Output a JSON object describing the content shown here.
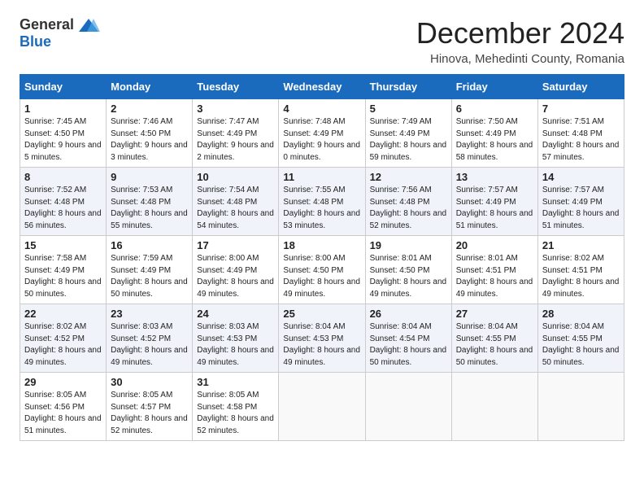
{
  "header": {
    "logo_general": "General",
    "logo_blue": "Blue",
    "title": "December 2024",
    "subtitle": "Hinova, Mehedinti County, Romania"
  },
  "weekdays": [
    "Sunday",
    "Monday",
    "Tuesday",
    "Wednesday",
    "Thursday",
    "Friday",
    "Saturday"
  ],
  "weeks": [
    [
      {
        "day": "1",
        "sunrise": "Sunrise: 7:45 AM",
        "sunset": "Sunset: 4:50 PM",
        "daylight": "Daylight: 9 hours and 5 minutes."
      },
      {
        "day": "2",
        "sunrise": "Sunrise: 7:46 AM",
        "sunset": "Sunset: 4:50 PM",
        "daylight": "Daylight: 9 hours and 3 minutes."
      },
      {
        "day": "3",
        "sunrise": "Sunrise: 7:47 AM",
        "sunset": "Sunset: 4:49 PM",
        "daylight": "Daylight: 9 hours and 2 minutes."
      },
      {
        "day": "4",
        "sunrise": "Sunrise: 7:48 AM",
        "sunset": "Sunset: 4:49 PM",
        "daylight": "Daylight: 9 hours and 0 minutes."
      },
      {
        "day": "5",
        "sunrise": "Sunrise: 7:49 AM",
        "sunset": "Sunset: 4:49 PM",
        "daylight": "Daylight: 8 hours and 59 minutes."
      },
      {
        "day": "6",
        "sunrise": "Sunrise: 7:50 AM",
        "sunset": "Sunset: 4:49 PM",
        "daylight": "Daylight: 8 hours and 58 minutes."
      },
      {
        "day": "7",
        "sunrise": "Sunrise: 7:51 AM",
        "sunset": "Sunset: 4:48 PM",
        "daylight": "Daylight: 8 hours and 57 minutes."
      }
    ],
    [
      {
        "day": "8",
        "sunrise": "Sunrise: 7:52 AM",
        "sunset": "Sunset: 4:48 PM",
        "daylight": "Daylight: 8 hours and 56 minutes."
      },
      {
        "day": "9",
        "sunrise": "Sunrise: 7:53 AM",
        "sunset": "Sunset: 4:48 PM",
        "daylight": "Daylight: 8 hours and 55 minutes."
      },
      {
        "day": "10",
        "sunrise": "Sunrise: 7:54 AM",
        "sunset": "Sunset: 4:48 PM",
        "daylight": "Daylight: 8 hours and 54 minutes."
      },
      {
        "day": "11",
        "sunrise": "Sunrise: 7:55 AM",
        "sunset": "Sunset: 4:48 PM",
        "daylight": "Daylight: 8 hours and 53 minutes."
      },
      {
        "day": "12",
        "sunrise": "Sunrise: 7:56 AM",
        "sunset": "Sunset: 4:48 PM",
        "daylight": "Daylight: 8 hours and 52 minutes."
      },
      {
        "day": "13",
        "sunrise": "Sunrise: 7:57 AM",
        "sunset": "Sunset: 4:49 PM",
        "daylight": "Daylight: 8 hours and 51 minutes."
      },
      {
        "day": "14",
        "sunrise": "Sunrise: 7:57 AM",
        "sunset": "Sunset: 4:49 PM",
        "daylight": "Daylight: 8 hours and 51 minutes."
      }
    ],
    [
      {
        "day": "15",
        "sunrise": "Sunrise: 7:58 AM",
        "sunset": "Sunset: 4:49 PM",
        "daylight": "Daylight: 8 hours and 50 minutes."
      },
      {
        "day": "16",
        "sunrise": "Sunrise: 7:59 AM",
        "sunset": "Sunset: 4:49 PM",
        "daylight": "Daylight: 8 hours and 50 minutes."
      },
      {
        "day": "17",
        "sunrise": "Sunrise: 8:00 AM",
        "sunset": "Sunset: 4:49 PM",
        "daylight": "Daylight: 8 hours and 49 minutes."
      },
      {
        "day": "18",
        "sunrise": "Sunrise: 8:00 AM",
        "sunset": "Sunset: 4:50 PM",
        "daylight": "Daylight: 8 hours and 49 minutes."
      },
      {
        "day": "19",
        "sunrise": "Sunrise: 8:01 AM",
        "sunset": "Sunset: 4:50 PM",
        "daylight": "Daylight: 8 hours and 49 minutes."
      },
      {
        "day": "20",
        "sunrise": "Sunrise: 8:01 AM",
        "sunset": "Sunset: 4:51 PM",
        "daylight": "Daylight: 8 hours and 49 minutes."
      },
      {
        "day": "21",
        "sunrise": "Sunrise: 8:02 AM",
        "sunset": "Sunset: 4:51 PM",
        "daylight": "Daylight: 8 hours and 49 minutes."
      }
    ],
    [
      {
        "day": "22",
        "sunrise": "Sunrise: 8:02 AM",
        "sunset": "Sunset: 4:52 PM",
        "daylight": "Daylight: 8 hours and 49 minutes."
      },
      {
        "day": "23",
        "sunrise": "Sunrise: 8:03 AM",
        "sunset": "Sunset: 4:52 PM",
        "daylight": "Daylight: 8 hours and 49 minutes."
      },
      {
        "day": "24",
        "sunrise": "Sunrise: 8:03 AM",
        "sunset": "Sunset: 4:53 PM",
        "daylight": "Daylight: 8 hours and 49 minutes."
      },
      {
        "day": "25",
        "sunrise": "Sunrise: 8:04 AM",
        "sunset": "Sunset: 4:53 PM",
        "daylight": "Daylight: 8 hours and 49 minutes."
      },
      {
        "day": "26",
        "sunrise": "Sunrise: 8:04 AM",
        "sunset": "Sunset: 4:54 PM",
        "daylight": "Daylight: 8 hours and 50 minutes."
      },
      {
        "day": "27",
        "sunrise": "Sunrise: 8:04 AM",
        "sunset": "Sunset: 4:55 PM",
        "daylight": "Daylight: 8 hours and 50 minutes."
      },
      {
        "day": "28",
        "sunrise": "Sunrise: 8:04 AM",
        "sunset": "Sunset: 4:55 PM",
        "daylight": "Daylight: 8 hours and 50 minutes."
      }
    ],
    [
      {
        "day": "29",
        "sunrise": "Sunrise: 8:05 AM",
        "sunset": "Sunset: 4:56 PM",
        "daylight": "Daylight: 8 hours and 51 minutes."
      },
      {
        "day": "30",
        "sunrise": "Sunrise: 8:05 AM",
        "sunset": "Sunset: 4:57 PM",
        "daylight": "Daylight: 8 hours and 52 minutes."
      },
      {
        "day": "31",
        "sunrise": "Sunrise: 8:05 AM",
        "sunset": "Sunset: 4:58 PM",
        "daylight": "Daylight: 8 hours and 52 minutes."
      },
      null,
      null,
      null,
      null
    ]
  ]
}
